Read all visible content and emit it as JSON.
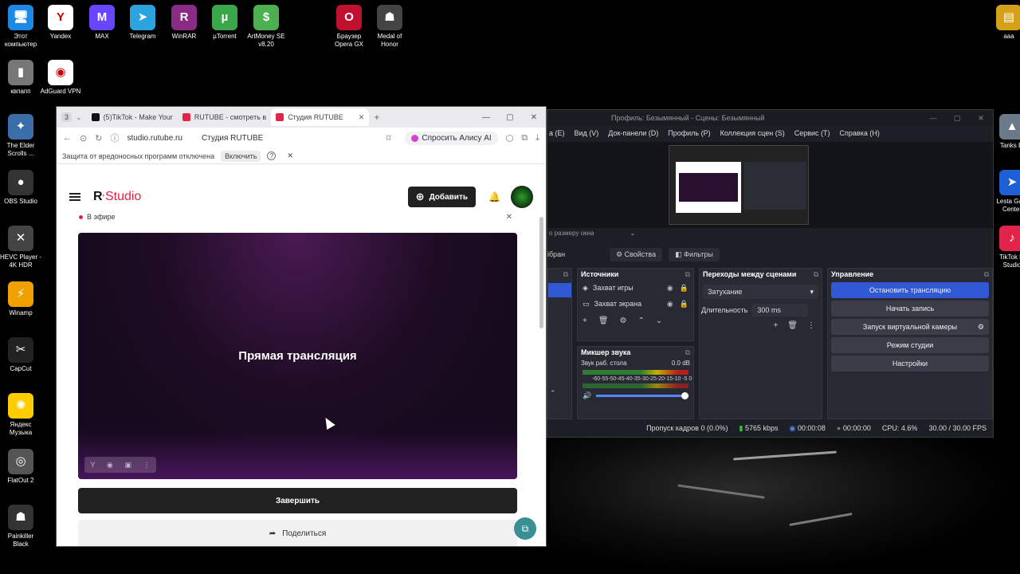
{
  "desktop": {
    "icons": [
      {
        "label": "Этот компьютер",
        "glyph": "🖥",
        "color": "#1e88e5"
      },
      {
        "label": "Yandex",
        "glyph": "Y",
        "color": "#ffffff"
      },
      {
        "label": "MAX",
        "glyph": "M",
        "color": "#6a45ff"
      },
      {
        "label": "Telegram",
        "glyph": "➤",
        "color": "#2aa3df"
      },
      {
        "label": "WinRAR",
        "glyph": "R",
        "color": "#8a2c86"
      },
      {
        "label": "µTorrent",
        "glyph": "µ",
        "color": "#3aa84a"
      },
      {
        "label": "ArtMoney SE v8.20",
        "glyph": "$",
        "color": "#4caf50"
      },
      {
        "label": "Браузер Opera GX",
        "glyph": "O",
        "color": "#c01030"
      },
      {
        "label": "Medal of Honor",
        "glyph": "☗",
        "color": "#444444"
      },
      {
        "label": "ааа",
        "glyph": "▤",
        "color": "#d4a017"
      },
      {
        "label": "квпапп",
        "glyph": "▮",
        "color": "#777777"
      },
      {
        "label": "AdGuard VPN",
        "glyph": "◉",
        "color": "#ffffff"
      },
      {
        "label": "The Elder Scrolls ...",
        "glyph": "✦",
        "color": "#3b6ea8"
      },
      {
        "label": "OBS Studio",
        "glyph": "●",
        "color": "#333333"
      },
      {
        "label": "HEVC Player - 4K HDR",
        "glyph": "✕",
        "color": "#444444"
      },
      {
        "label": "Winamp",
        "glyph": "⚡",
        "color": "#f0a000"
      },
      {
        "label": "CapCut",
        "glyph": "✂",
        "color": "#222222"
      },
      {
        "label": "Яндекс Музыка",
        "glyph": "✺",
        "color": "#ffcc00"
      },
      {
        "label": "FlatOut 2",
        "glyph": "◎",
        "color": "#555555"
      },
      {
        "label": "Painkiller Black",
        "glyph": "☗",
        "color": "#333333"
      },
      {
        "label": "Tanks Bl",
        "glyph": "▲",
        "color": "#6a7a8a"
      },
      {
        "label": "Lesta Gam Center",
        "glyph": "➤",
        "color": "#1e5fd6"
      },
      {
        "label": "TikTok LI Studio",
        "glyph": "♪",
        "color": "#e0244a"
      }
    ]
  },
  "browser": {
    "tab_count": "3",
    "tabs": [
      {
        "label": "(5)TikTok - Make Your",
        "fav_color": "#111111"
      },
      {
        "label": "RUTUBE - смотреть в",
        "fav_color": "#e0244a"
      },
      {
        "label": "Студия RUTUBE",
        "fav_color": "#e0244a"
      }
    ],
    "new_tab": "+",
    "window_min": "—",
    "window_max": "▢",
    "window_close": "✕",
    "url": "studio.rutube.ru",
    "page_title": "Студия RUTUBE",
    "alisa_label": "Спросить Алису AI",
    "protection_text": "Защита от вредоносных программ отключена",
    "protection_button": "Включить",
    "protection_help": "?",
    "protection_close": "✕"
  },
  "studio": {
    "logo_r": "R",
    "logo_studio": "Studio",
    "add_button": "Добавить",
    "live_label": "В эфире",
    "player_title": "Прямая трансляция",
    "finish_button": "Завершить",
    "share_button": "Поделиться"
  },
  "obs": {
    "title": "Профиль: Безымянный - Сцены: Безымянный",
    "menu": [
      "а (E)",
      "Вид (V)",
      "Док-панели (D)",
      "Профиль (P)",
      "Коллекция сцен (S)",
      "Сервис (T)",
      "Справка (H)"
    ],
    "scale_label": "о размеру окна",
    "selected_label": "ібран",
    "properties_button": "Свойства",
    "filters_button": "Фильтры",
    "sources_title": "Источники",
    "sources": [
      {
        "label": "Захват игры"
      },
      {
        "label": "Захват экрана"
      }
    ],
    "transitions_title": "Переходы между сценами",
    "transition_value": "Затухание",
    "duration_label": "Длительность",
    "duration_value": "300 ms",
    "mixer_title": "Микшер звука",
    "mixer_track": "Звук раб. стола",
    "mixer_db": "0.0 dB",
    "mixer_scale": "-60-55-50-45-40-35-30-25-20-15-10 -5 0",
    "controls_title": "Управление",
    "controls": [
      {
        "label": "Остановить трансляцию",
        "active": true
      },
      {
        "label": "Начать запись",
        "active": false
      },
      {
        "label": "Запуск виртуальной камеры",
        "active": false
      },
      {
        "label": "Режим студии",
        "active": false
      },
      {
        "label": "Настройки",
        "active": false
      }
    ],
    "status": {
      "dropped": "Пропуск кадров 0 (0.0%)",
      "bitrate": "5765 kbps",
      "stream_time": "00:00:08",
      "rec_time": "00:00:00",
      "cpu": "CPU: 4.6%",
      "fps": "30.00 / 30.00 FPS"
    }
  }
}
